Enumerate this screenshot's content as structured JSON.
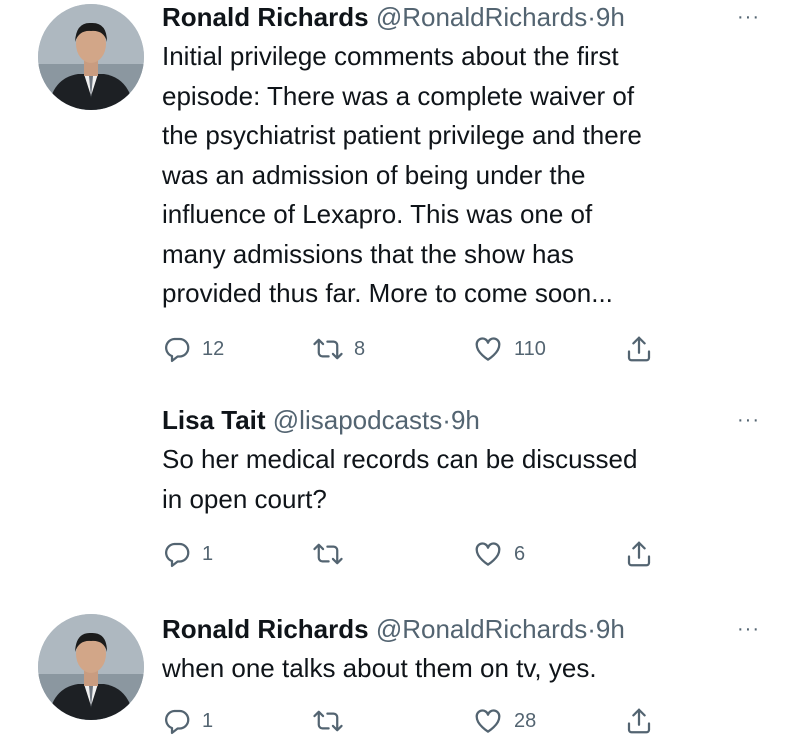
{
  "tweets": [
    {
      "name": "Ronald Richards",
      "handle": "@RonaldRichards",
      "dot": "·",
      "time": "9h",
      "more": "···",
      "text": "Initial privilege comments about the first\nepisode:  There was a complete waiver of\nthe psychiatrist patient privilege and there\nwas an admission of being under the\ninfluence of Lexapro.  This was one of\nmany admissions that the show has\nprovided thus far.  More to come soon...",
      "replies": "12",
      "retweets": "8",
      "likes": "110"
    },
    {
      "name": "Lisa Tait",
      "handle": "@lisapodcasts",
      "dot": "·",
      "time": "9h",
      "more": "···",
      "text": "So her medical records can be discussed\nin open court?",
      "replies": "1",
      "retweets": "",
      "likes": "6"
    },
    {
      "name": "Ronald Richards",
      "handle": "@RonaldRichards",
      "dot": "·",
      "time": "9h",
      "more": "···",
      "text": "when one talks about them on tv, yes.",
      "replies": "1",
      "retweets": "",
      "likes": "28"
    }
  ],
  "icons": {
    "reply": "reply-icon",
    "retweet": "retweet-icon",
    "like": "heart-icon",
    "share": "share-icon",
    "more": "more-icon"
  },
  "colors": {
    "text": "#0f1419",
    "secondary": "#536471",
    "background": "#ffffff"
  }
}
